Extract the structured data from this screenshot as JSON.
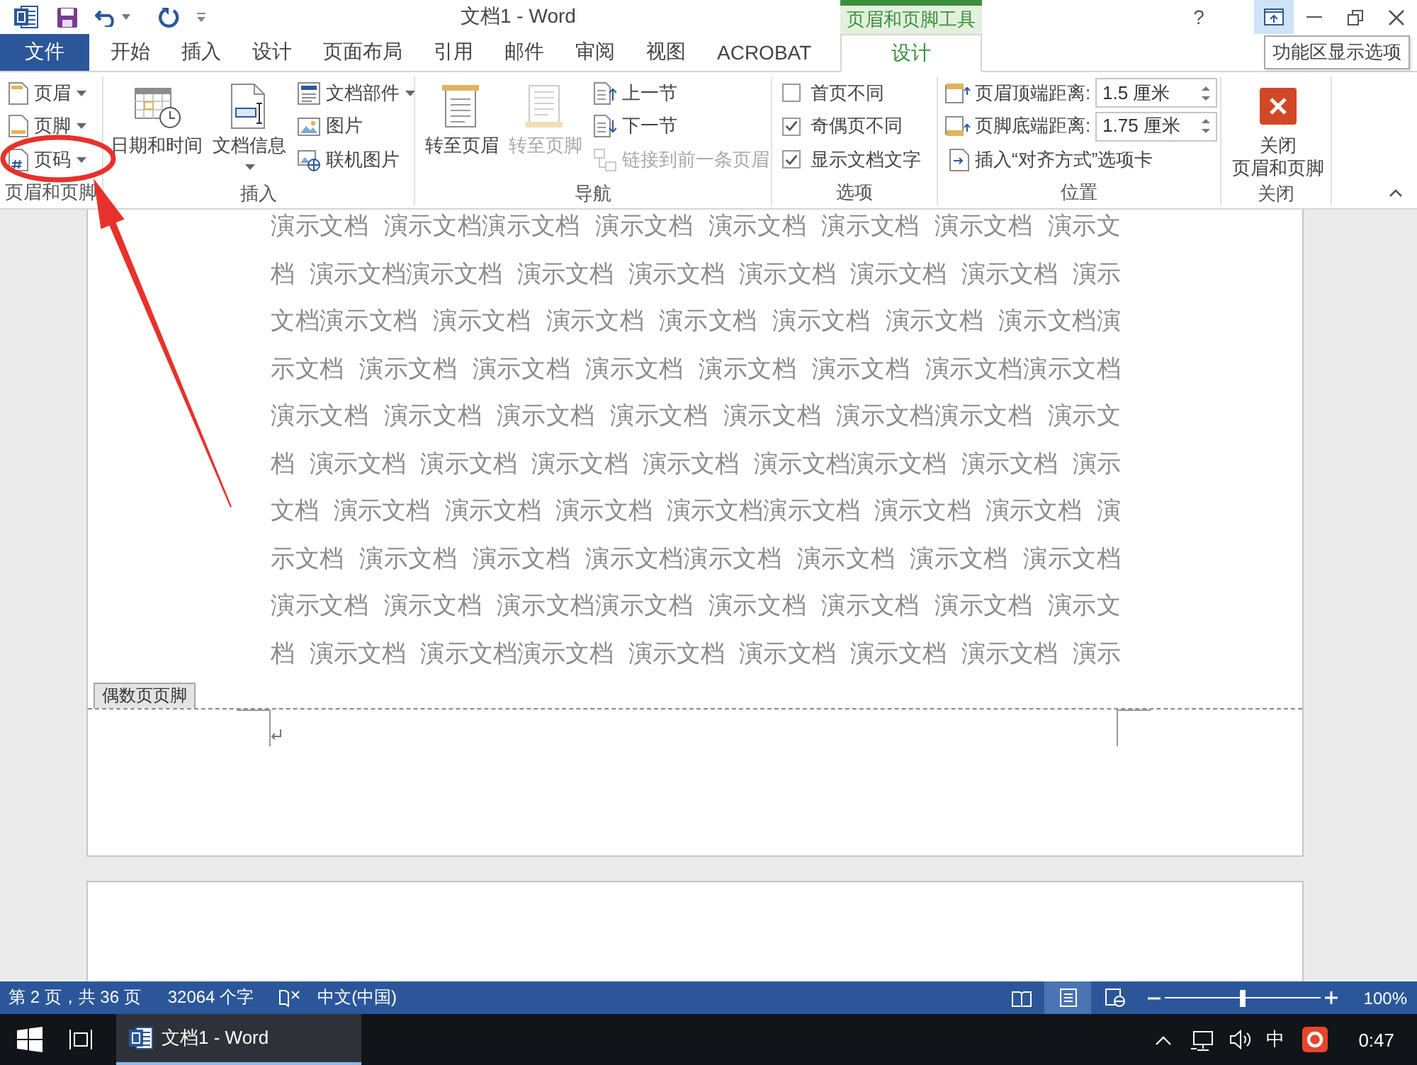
{
  "title_bar": {
    "title": "文档1 - Word",
    "tool_header": "页眉和页脚工具",
    "help": "?"
  },
  "tabs": [
    {
      "label": "文件",
      "kind": "file",
      "selected": false
    },
    {
      "label": "开始",
      "kind": "tab",
      "selected": false
    },
    {
      "label": "插入",
      "kind": "tab",
      "selected": false
    },
    {
      "label": "设计",
      "kind": "tab",
      "selected": false
    },
    {
      "label": "页面布局",
      "kind": "tab",
      "selected": false
    },
    {
      "label": "引用",
      "kind": "tab",
      "selected": false
    },
    {
      "label": "邮件",
      "kind": "tab",
      "selected": false
    },
    {
      "label": "审阅",
      "kind": "tab",
      "selected": false
    },
    {
      "label": "视图",
      "kind": "tab",
      "selected": false
    },
    {
      "label": "ACROBAT",
      "kind": "tab",
      "selected": false
    },
    {
      "label": "设计",
      "kind": "contextual",
      "selected": true
    }
  ],
  "tooltip": "功能区显示选项",
  "ribbon_groups": [
    {
      "label": "页眉和页脚",
      "columns": [
        [
          {
            "kind": "small",
            "label": "页眉",
            "dropdown": true,
            "disabled": false
          },
          {
            "kind": "small",
            "label": "页脚",
            "dropdown": true,
            "disabled": false
          },
          {
            "kind": "small",
            "label": "页码",
            "dropdown": true,
            "disabled": false
          }
        ]
      ]
    },
    {
      "label": "插入",
      "columns": [
        [
          {
            "kind": "large",
            "label": "日期和时间",
            "dropdown": false,
            "disabled": false
          }
        ],
        [
          {
            "kind": "large",
            "label": "文档信息",
            "dropdown": true,
            "disabled": false
          }
        ],
        [
          {
            "kind": "small",
            "label": "文档部件",
            "dropdown": true,
            "disabled": false
          },
          {
            "kind": "small",
            "label": "图片",
            "dropdown": false,
            "disabled": false
          },
          {
            "kind": "small",
            "label": "联机图片",
            "dropdown": false,
            "disabled": false
          }
        ]
      ]
    },
    {
      "label": "导航",
      "columns": [
        [
          {
            "kind": "large",
            "label": "转至页眉",
            "dropdown": false,
            "disabled": false
          }
        ],
        [
          {
            "kind": "large",
            "label": "转至页脚",
            "dropdown": false,
            "disabled": true
          }
        ],
        [
          {
            "kind": "small",
            "label": "上一节",
            "dropdown": false,
            "disabled": false
          },
          {
            "kind": "small",
            "label": "下一节",
            "dropdown": false,
            "disabled": false
          },
          {
            "kind": "small",
            "label": "链接到前一条页眉",
            "dropdown": false,
            "disabled": true
          }
        ]
      ]
    },
    {
      "label": "选项",
      "columns": [
        [
          {
            "kind": "checkbox",
            "label": "首页不同",
            "checked": false
          },
          {
            "kind": "checkbox",
            "label": "奇偶页不同",
            "checked": true
          },
          {
            "kind": "checkbox",
            "label": "显示文档文字",
            "checked": true
          }
        ]
      ]
    },
    {
      "label": "位置",
      "columns": [
        [
          {
            "kind": "spin",
            "label": "页眉顶端距离:",
            "value": "1.5 厘米"
          },
          {
            "kind": "spin",
            "label": "页脚底端距离:",
            "value": "1.75 厘米"
          },
          {
            "kind": "small",
            "label": "插入“对齐方式”选项卡",
            "dropdown": false,
            "disabled": false
          }
        ]
      ]
    },
    {
      "label": "关闭",
      "columns": [
        [
          {
            "kind": "large_wrapped",
            "label": "关闭页眉和页脚",
            "dropdown": false,
            "disabled": false
          }
        ]
      ]
    }
  ],
  "document": {
    "lines": [
      "演示文档 演示文档演示文档 演示文档 演示文档 演示文档 演示文档 演示文",
      "档 演示文档演示文档 演示文档 演示文档 演示文档 演示文档 演示文档 演示",
      "文档演示文档 演示文档 演示文档 演示文档 演示文档 演示文档 演示文档演",
      "示文档 演示文档 演示文档 演示文档 演示文档 演示文档 演示文档演示文档",
      "演示文档 演示文档 演示文档 演示文档 演示文档 演示文档演示文档 演示文",
      "档 演示文档 演示文档 演示文档 演示文档 演示文档演示文档 演示文档 演示",
      "文档 演示文档 演示文档 演示文档 演示文档演示文档 演示文档 演示文档 演",
      "示文档 演示文档 演示文档 演示文档演示文档 演示文档 演示文档 演示文档",
      "演示文档 演示文档 演示文档演示文档 演示文档 演示文档 演示文档 演示文",
      "档 演示文档 演示文档演示文档 演示文档 演示文档 演示文档 演示文档 演示"
    ],
    "footer_label": "偶数页页脚"
  },
  "status_bar": {
    "page": "第 2 页，共 36 页",
    "words": "32064 个字",
    "language": "中文(中国)",
    "views": [
      {
        "selected": false
      },
      {
        "selected": true
      },
      {
        "selected": false
      }
    ],
    "zoom": {
      "level": 0.5,
      "reading": "100%"
    }
  },
  "taskbar": {
    "apps": [
      {
        "label": "文档1 - Word",
        "selected": true
      }
    ],
    "ime": "中",
    "clock": "0:47"
  }
}
